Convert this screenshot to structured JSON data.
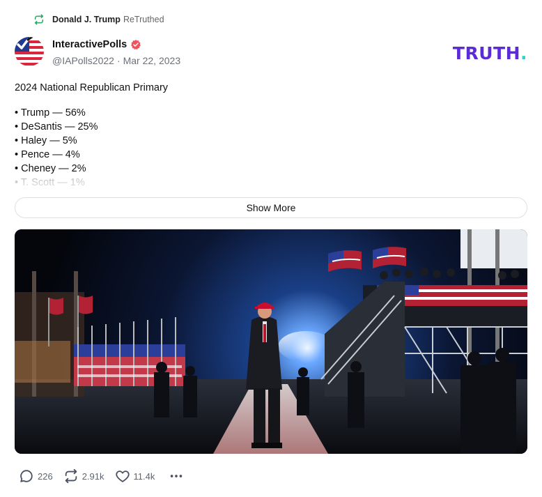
{
  "retruth": {
    "icon": "retruth-icon",
    "user": "Donald J. Trump",
    "action": "ReTruthed"
  },
  "post": {
    "author_name": "InteractivePolls",
    "verified_icon": "verified-badge-icon",
    "handle": "@IAPolls2022",
    "separator": "·",
    "date": "Mar 22, 2023",
    "title": "2024 National Republican Primary",
    "poll_items": [
      "• Trump — 56%",
      "• DeSantis — 25%",
      "• Haley — 5%",
      "• Pence — 4%",
      "• Cheney — 2%",
      "• T. Scott — 1%"
    ],
    "show_more_label": "Show More"
  },
  "brand": {
    "logo_text": "TRUTH",
    "logo_dot": ".",
    "logo_color": "#5b2bd6",
    "dot_color": "#2bd3c9"
  },
  "actions": {
    "reply_count": "226",
    "retruth_count": "2.91k",
    "like_count": "11.4k",
    "more_icon": "more-icon"
  }
}
